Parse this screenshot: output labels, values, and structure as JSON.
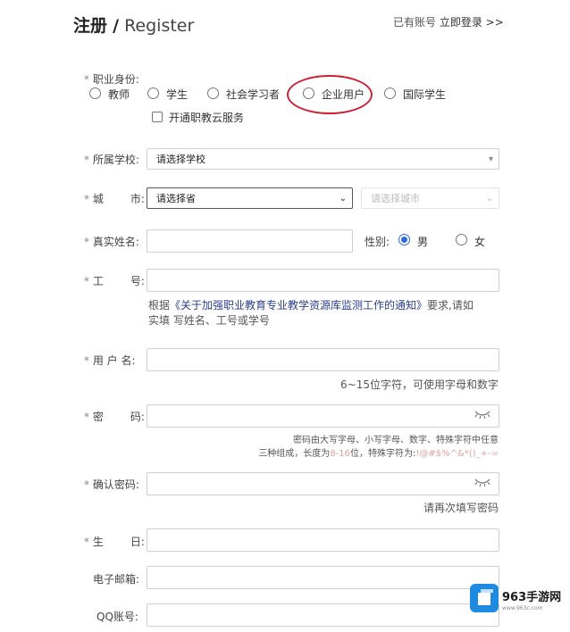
{
  "header": {
    "title_cn": "注册",
    "title_sep": "/",
    "title_en": "Register",
    "have_account": "已有账号",
    "login_link": "立即登录 >>"
  },
  "identity": {
    "label": "职业身份:",
    "options": [
      "教师",
      "学生",
      "社会学习者",
      "企业用户",
      "国际学生"
    ],
    "vocational_cloud": "开通职教云服务"
  },
  "school": {
    "label": "所属学校:",
    "placeholder": "请选择学校"
  },
  "city": {
    "label_a": "城",
    "label_b": "市:",
    "province": "请选择省",
    "city": "请选择城市"
  },
  "name": {
    "label": "真实姓名:"
  },
  "gender": {
    "label": "性别:",
    "male": "男",
    "female": "女",
    "selected": "男"
  },
  "job_no": {
    "label_a": "工",
    "label_b": "号:",
    "note_prefix": "根据",
    "note_link": "《关于加强职业教育专业教学资源库监测工作的通知》",
    "note_suffix": "要求,请如",
    "note_line2": "实填 写姓名、工号或学号"
  },
  "username": {
    "label": "用 户 名:",
    "hint": "6~15位字符，可使用字母和数字"
  },
  "password": {
    "label_a": "密",
    "label_b": "码:",
    "hint1": "密码由大写字母、小写字母、数字、特殊字符中任意",
    "hint2_a": "三种组成，长度为",
    "hint2_range": "8-16",
    "hint2_b": "位，特殊字符为:",
    "hint2_chars": "!@#$%^&*()_+-="
  },
  "confirm": {
    "label": "确认密码:",
    "hint": "请再次填写密码"
  },
  "birthday": {
    "label_a": "生",
    "label_b": "日:"
  },
  "email": {
    "label": "电子邮箱:"
  },
  "qq": {
    "label": "QQ账号:"
  },
  "watermark": {
    "name": "963手游网",
    "url": "www.963c.com"
  },
  "colors": {
    "accent": "#2b6bd8",
    "highlight_circle": "#cc2233",
    "link": "#2a3f8f"
  }
}
